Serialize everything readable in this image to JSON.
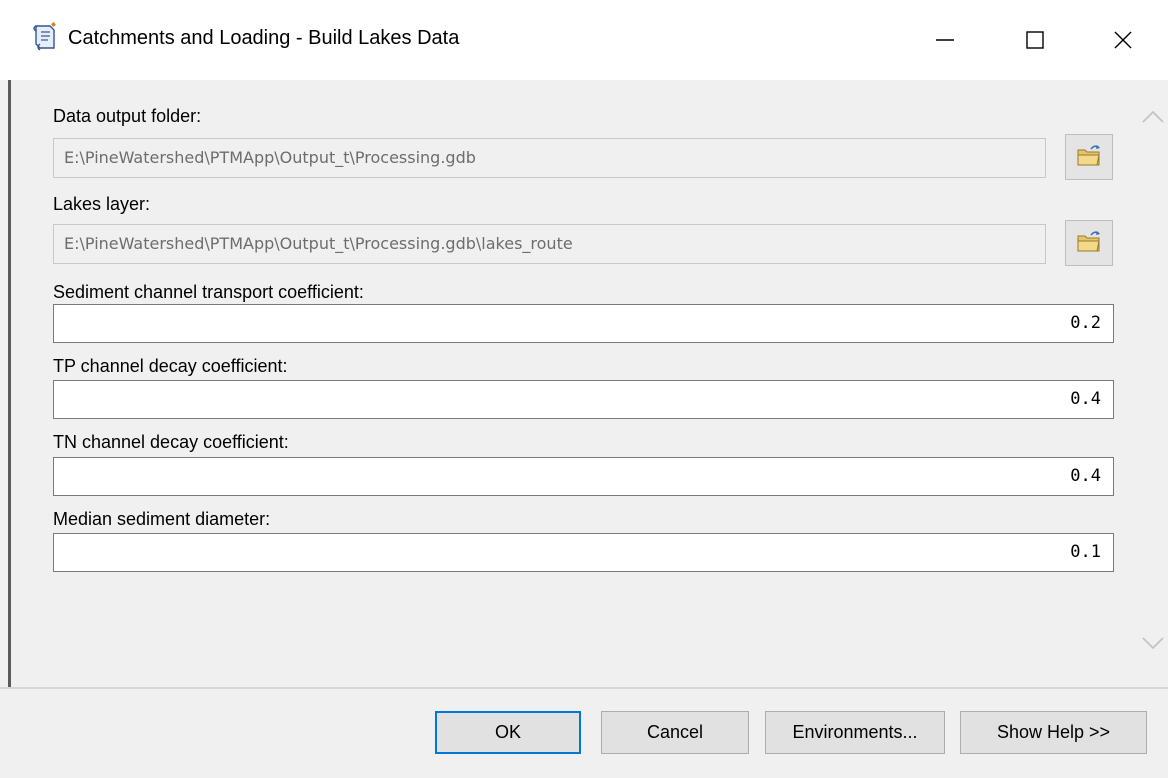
{
  "window": {
    "title": "Catchments and Loading - Build Lakes Data",
    "title_icon": "script-tool-icon",
    "controls": [
      "minimize-icon",
      "maximize-icon",
      "close-icon"
    ]
  },
  "params": {
    "output_folder": {
      "label": "Data output folder:",
      "value": "E:\\PineWatershed\\PTMApp\\Output_t\\Processing.gdb"
    },
    "lakes_layer": {
      "label": "Lakes layer:",
      "value": "E:\\PineWatershed\\PTMApp\\Output_t\\Processing.gdb\\lakes_route"
    },
    "sediment_coeff": {
      "label": "Sediment channel transport coefficient:",
      "value": "0.2"
    },
    "tp_coeff": {
      "label": "TP channel decay coefficient:",
      "value": "0.4"
    },
    "tn_coeff": {
      "label": "TN channel decay coefficient:",
      "value": "0.4"
    },
    "median_diameter": {
      "label": "Median sediment diameter:",
      "value": "0.1"
    }
  },
  "buttons": {
    "ok": "OK",
    "cancel": "Cancel",
    "environments": "Environments...",
    "show_help": "Show Help >>"
  },
  "colors": {
    "accent": "#0078d7",
    "dialog_bg": "#f0f0f0",
    "disabled_text": "#6d6d6d"
  }
}
